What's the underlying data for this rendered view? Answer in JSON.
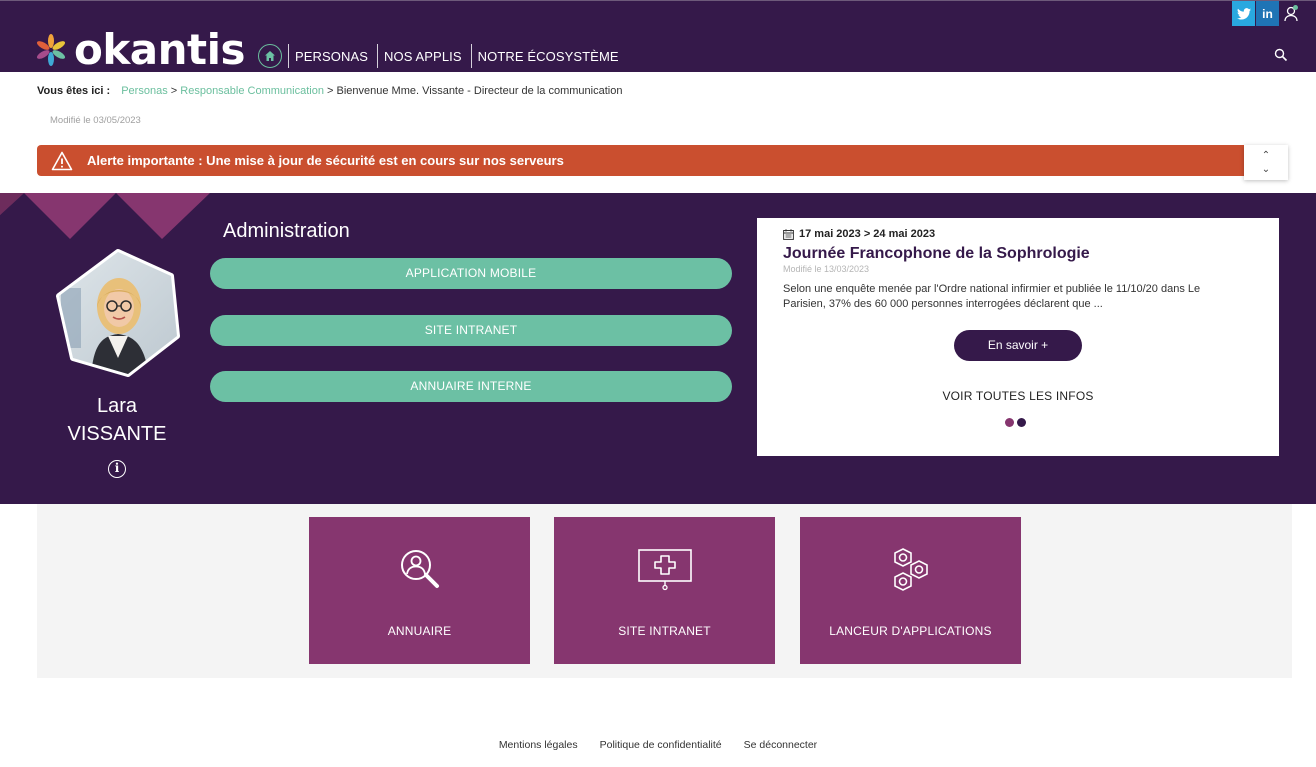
{
  "header": {
    "logo_text": "okantis",
    "nav": [
      "PERSONAS",
      "NOS APPLIS",
      "NOTRE ÉCOSYSTÈME"
    ],
    "social": {
      "twitter": "t",
      "linkedin": "in"
    }
  },
  "breadcrumb": {
    "label": "Vous êtes ici :",
    "items": [
      "Personas",
      "Responsable Communication",
      "Bienvenue Mme. Vissante - Directeur de la communication"
    ],
    "separator": ">"
  },
  "modified": "Modifié le 03/05/2023",
  "alert": {
    "text": "Alerte importante : Une mise à jour de sécurité est en cours sur nos serveurs",
    "up": "⌃",
    "down": "⌄"
  },
  "profile": {
    "first_name": "Lara",
    "last_name": "VISSANTE",
    "info": "i"
  },
  "admin": {
    "title": "Administration",
    "buttons": [
      "APPLICATION MOBILE",
      "SITE INTRANET",
      "ANNUAIRE INTERNE"
    ]
  },
  "news": {
    "date": "17 mai 2023 > 24 mai 2023",
    "title": "Journée Francophone de la Sophrologie",
    "modified": "Modifié le 13/03/2023",
    "body": "Selon une enquête menée par l'Ordre national infirmier et publiée le 11/10/20 dans Le Parisien, 37% des 60 000 personnes interrogées déclarent que ...",
    "more_label": "En savoir +",
    "all_label": "VOIR TOUTES LES INFOS"
  },
  "tiles": [
    {
      "label": "ANNUAIRE",
      "icon": "search-user-icon"
    },
    {
      "label": "SITE INTRANET",
      "icon": "screen-plus-icon"
    },
    {
      "label": "LANCEUR D'APPLICATIONS",
      "icon": "hexagons-icon"
    }
  ],
  "footer": [
    "Mentions légales",
    "Politique de confidentialité",
    "Se déconnecter"
  ],
  "colors": {
    "brand_dark": "#35194a",
    "accent_green": "#6cc0a4",
    "alert": "#ca4f2f",
    "tile": "#86366f"
  }
}
